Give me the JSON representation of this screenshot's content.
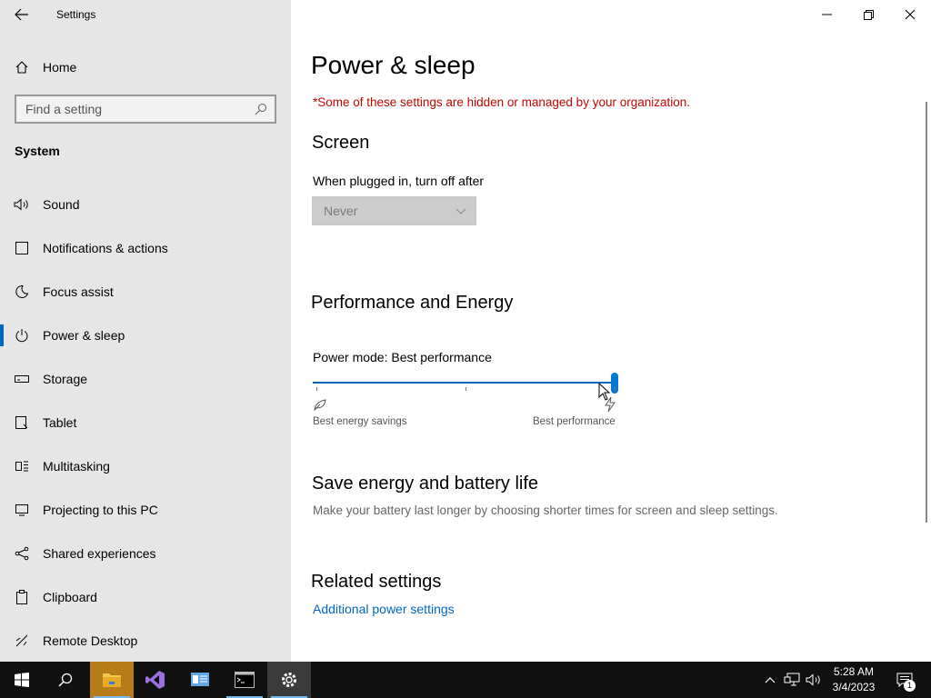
{
  "window": {
    "title": "Settings",
    "minimize": "—",
    "restore": "❐",
    "close": "✕"
  },
  "sidebar": {
    "home_label": "Home",
    "search_placeholder": "Find a setting",
    "section": "System",
    "items": [
      {
        "label": "Sound",
        "icon": "speaker-icon",
        "active": false
      },
      {
        "label": "Notifications & actions",
        "icon": "notification-icon",
        "active": false
      },
      {
        "label": "Focus assist",
        "icon": "moon-icon",
        "active": false
      },
      {
        "label": "Power & sleep",
        "icon": "power-icon",
        "active": true
      },
      {
        "label": "Storage",
        "icon": "storage-icon",
        "active": false
      },
      {
        "label": "Tablet",
        "icon": "tablet-icon",
        "active": false
      },
      {
        "label": "Multitasking",
        "icon": "multitasking-icon",
        "active": false
      },
      {
        "label": "Projecting to this PC",
        "icon": "projecting-icon",
        "active": false
      },
      {
        "label": "Shared experiences",
        "icon": "shared-experiences-icon",
        "active": false
      },
      {
        "label": "Clipboard",
        "icon": "clipboard-icon",
        "active": false
      },
      {
        "label": "Remote Desktop",
        "icon": "remote-desktop-icon",
        "active": false
      }
    ]
  },
  "main": {
    "title": "Power & sleep",
    "org_note": "*Some of these settings are hidden or managed by your organization.",
    "screen": {
      "heading": "Screen",
      "plugged_label": "When plugged in, turn off after",
      "plugged_value": "Never"
    },
    "performance": {
      "heading": "Performance and Energy",
      "power_mode_label": "Power mode: Best performance",
      "slider_value": 1.0,
      "left_caption": "Best energy savings",
      "right_caption": "Best performance"
    },
    "save_energy": {
      "heading": "Save energy and battery life",
      "description": "Make your battery last longer by choosing shorter times for screen and sleep settings."
    },
    "related": {
      "heading": "Related settings",
      "link": "Additional power settings"
    }
  },
  "taskbar": {
    "time": "5:28 AM",
    "date": "3/4/2023",
    "notification_count": "1",
    "apps": [
      "start-icon",
      "search-icon",
      "file-explorer-icon",
      "visual-studio-icon",
      "server-manager-icon",
      "command-prompt-icon",
      "settings-icon"
    ]
  },
  "colors": {
    "accent": "#0067c0",
    "org_note": "#c50500",
    "sidebar_bg": "#e6e6e6",
    "taskbar_bg": "#101010"
  }
}
